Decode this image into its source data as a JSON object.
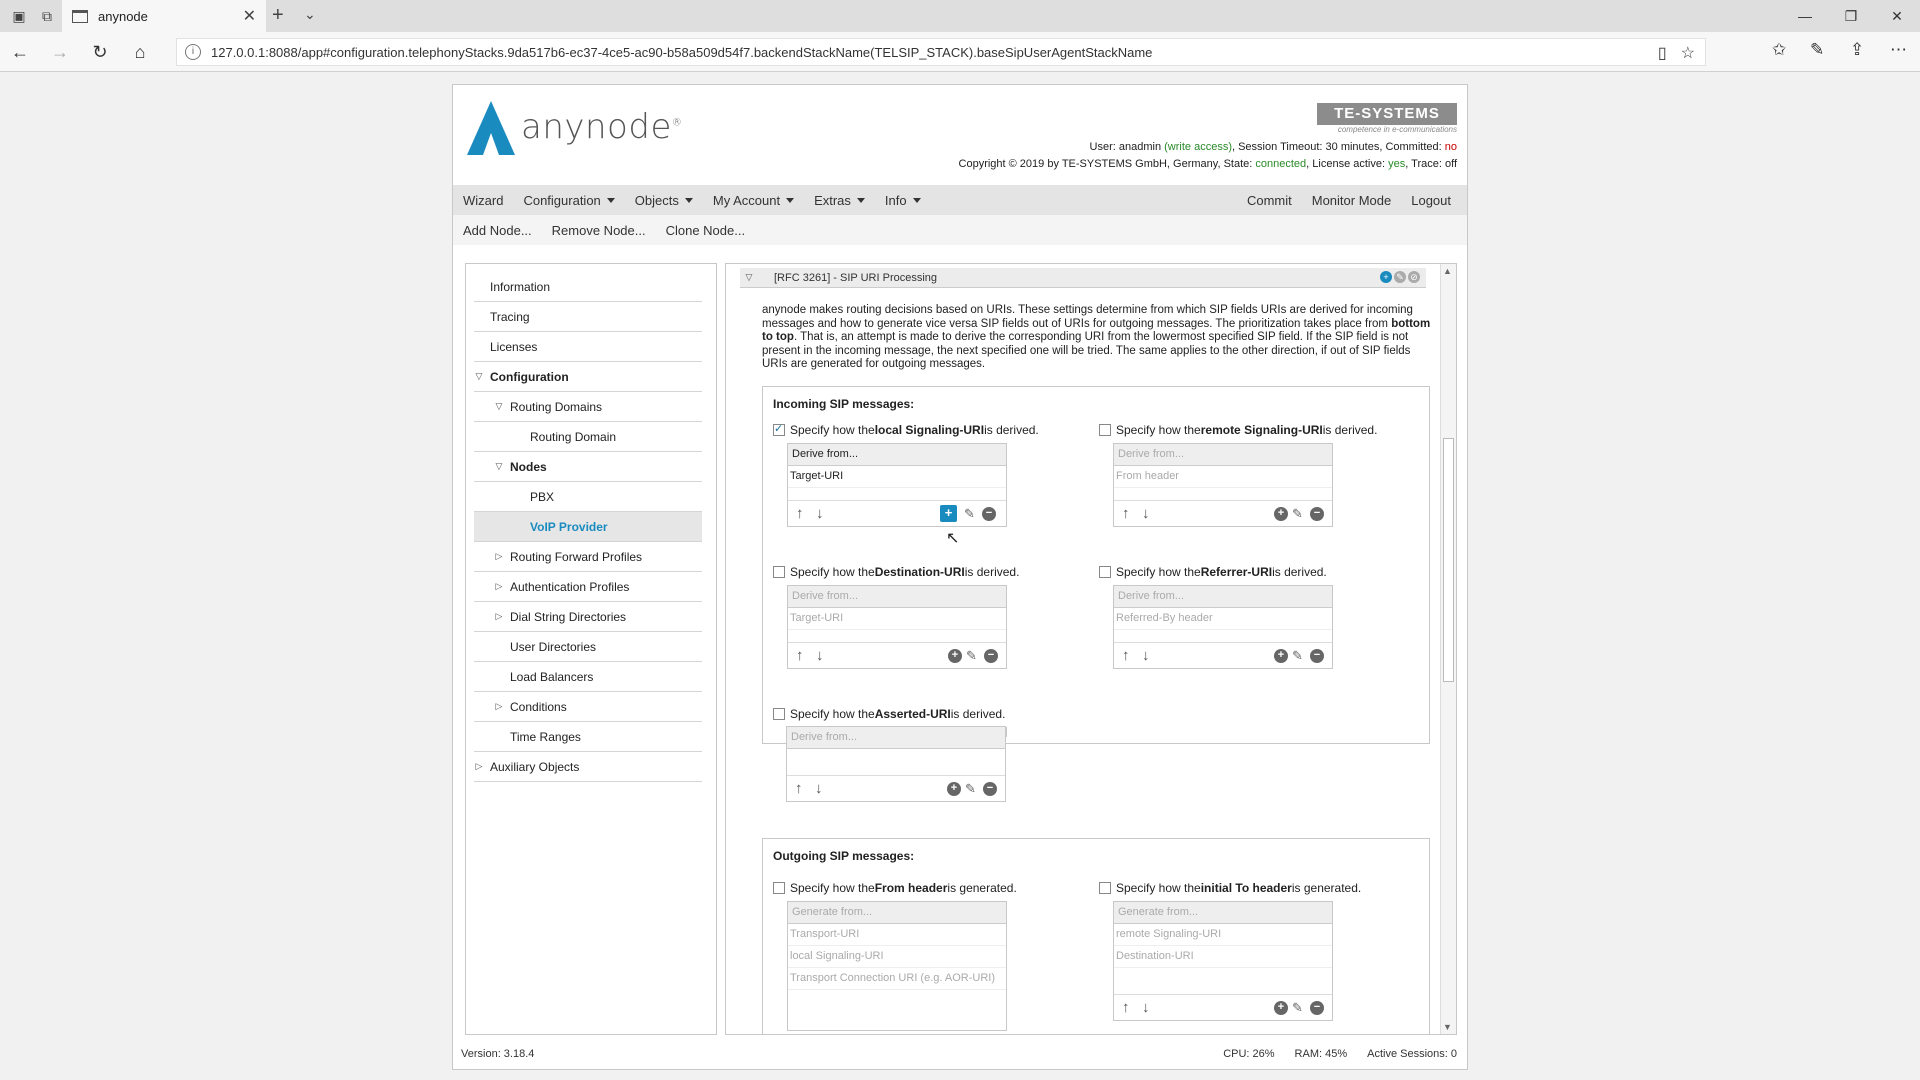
{
  "browser": {
    "tab_title": "anynode",
    "url": "127.0.0.1:8088/app#configuration.telephonyStacks.9da517b6-ec37-4ce5-ac90-b58a509d54f7.backendStackName(TELSIP_STACK).baseSipUserAgentStackName"
  },
  "header": {
    "logo_text": "anynode",
    "brand_text": "TE-SYSTEMS",
    "brand_sub": "competence in e-communications",
    "user_label": "User: ",
    "user_name": "anadmin",
    "user_access": "(write access)",
    "session_text": ", Session Timeout: 30 minutes, Committed: ",
    "committed_value": "no",
    "copyright": "Copyright © 2019 by TE-SYSTEMS GmbH, Germany, State: ",
    "state_value": "connected",
    "license_label": ", License active: ",
    "license_value": "yes",
    "trace_label": ", Trace: ",
    "trace_value": "off"
  },
  "menu": {
    "wizard": "Wizard",
    "configuration": "Configuration",
    "objects": "Objects",
    "my_account": "My Account",
    "extras": "Extras",
    "info": "Info",
    "commit": "Commit",
    "monitor_mode": "Monitor Mode",
    "logout": "Logout"
  },
  "submenu": {
    "add_node": "Add Node...",
    "remove_node": "Remove Node...",
    "clone_node": "Clone Node..."
  },
  "tree": [
    "Information",
    "Tracing",
    "Licenses",
    "Configuration",
    "Routing Domains",
    "Routing Domain",
    "Nodes",
    "PBX",
    "VoIP Provider",
    "Routing Forward Profiles",
    "Authentication Profiles",
    "Dial String Directories",
    "User Directories",
    "Load Balancers",
    "Conditions",
    "Time Ranges",
    "Auxiliary Objects"
  ],
  "section": {
    "title": "[RFC 3261] - SIP URI Processing",
    "description_1": "anynode makes routing decisions based on URIs. These settings determine from which SIP fields URIs are derived for incoming messages and how to generate vice versa SIP fields out of URIs for outgoing messages. The prioritization takes place from ",
    "description_bold": "bottom to top",
    "description_2": ". That is, an attempt is made to derive the corresponding URI from the lowermost specified SIP field. If the SIP field is not present in the incoming message, the next specified one will be tried. The same applies to the other direction, if out of SIP fields URIs are generated for outgoing messages."
  },
  "incoming": {
    "title": "Incoming SIP messages:",
    "local": {
      "pre": "Specify how the ",
      "bold": "local Signaling-URI",
      "post": " is derived.",
      "checked": true,
      "head": "Derive from...",
      "rows": [
        "Target-URI"
      ]
    },
    "remote": {
      "pre": "Specify how the ",
      "bold": "remote Signaling-URI",
      "post": " is derived.",
      "checked": false,
      "head": "Derive from...",
      "rows": [
        "From header"
      ]
    },
    "destination": {
      "pre": "Specify how the ",
      "bold": "Destination-URI",
      "post": " is derived.",
      "checked": false,
      "head": "Derive from...",
      "rows": [
        "Target-URI"
      ]
    },
    "referrer": {
      "pre": "Specify how the ",
      "bold": "Referrer-URI",
      "post": " is derived.",
      "checked": false,
      "head": "Derive from...",
      "rows": [
        "Referred-By header"
      ]
    },
    "asserted": {
      "pre": "Specify how the ",
      "bold": "Asserted-URI",
      "post": " is derived.",
      "checked": false,
      "head": "Derive from...",
      "rows": []
    }
  },
  "outgoing": {
    "title": "Outgoing SIP messages:",
    "from": {
      "pre": "Specify how the ",
      "bold": "From header",
      "post": " is generated.",
      "checked": false,
      "head": "Generate from...",
      "rows": [
        "Transport-URI",
        "local Signaling-URI",
        "Transport Connection URI (e.g. AOR-URI)"
      ]
    },
    "to": {
      "pre": "Specify how the ",
      "bold": "initial To header",
      "post": " is generated.",
      "checked": false,
      "head": "Generate from...",
      "rows": [
        "remote Signaling-URI",
        "Destination-URI"
      ]
    }
  },
  "footer": {
    "version": "Version: 3.18.4",
    "cpu": "CPU: 26%",
    "ram": "RAM: 45%",
    "sessions": "Active Sessions: 0"
  },
  "colors": {
    "accent": "#1a8bbf",
    "connected": "#2a8a2a",
    "no": "#cc0000"
  }
}
